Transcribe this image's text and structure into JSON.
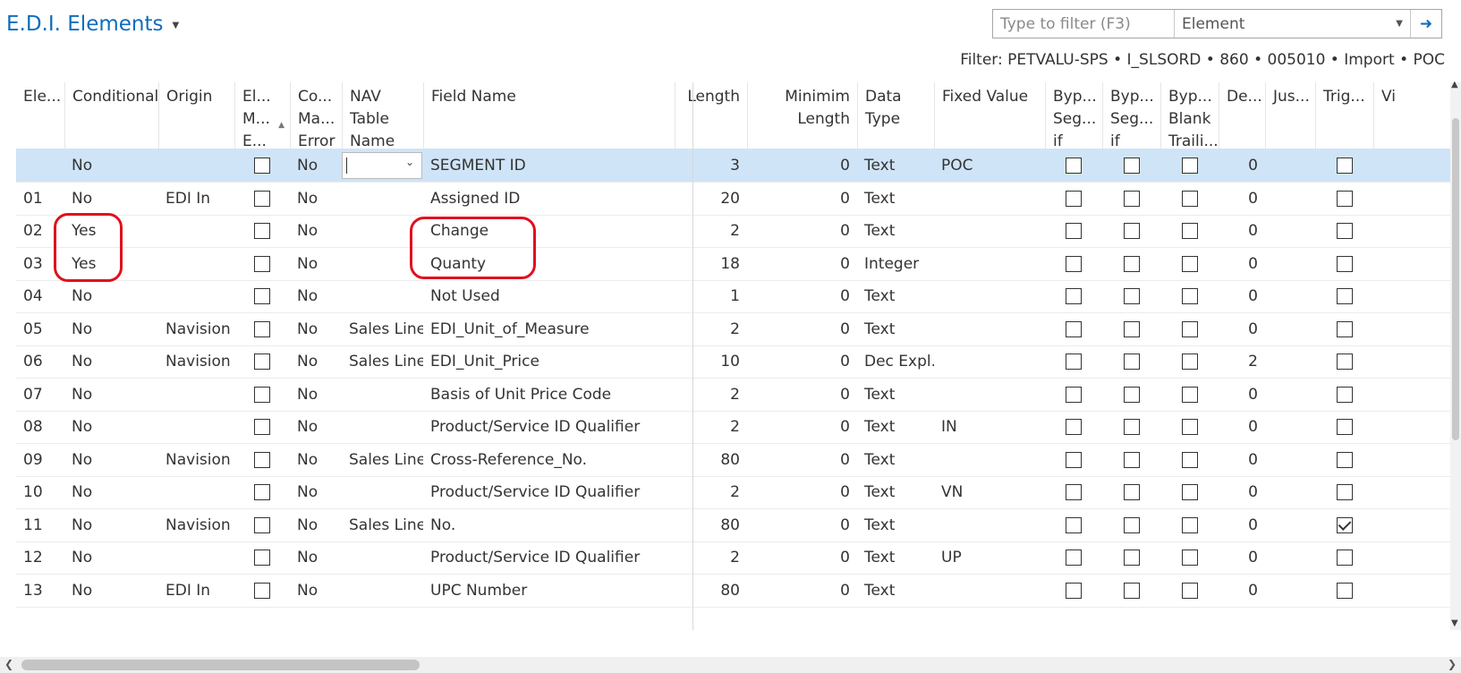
{
  "title": "E.D.I. Elements",
  "filter": {
    "placeholder": "Type to filter (F3)",
    "field": "Element",
    "summary": "Filter: PETVALU-SPS • I_SLSORD • 860 • 005010 • Import • POC"
  },
  "columns": [
    "Ele...",
    "Conditional",
    "Origin",
    "El... M... E...",
    "Co... Ma... Error",
    "NAV Table Name",
    "Field Name",
    "Length",
    "Minimim Length",
    "Data Type",
    "Fixed Value",
    "Byp... Seg... if Bl...",
    "Byp... Seg... if N...",
    "Byp... Blank Traili...",
    "De...",
    "Jus...",
    "Trig...",
    "Vi"
  ],
  "rows": [
    {
      "element": "",
      "conditional": "No",
      "origin": "",
      "error": "No",
      "nav_table": "",
      "field_name": "SEGMENT ID",
      "length": "3",
      "min_length": "0",
      "data_type": "Text",
      "fixed_value": "POC",
      "decimals": "0",
      "trigger": false,
      "selected": true
    },
    {
      "element": "01",
      "conditional": "No",
      "origin": "EDI In",
      "error": "No",
      "nav_table": "",
      "field_name": "Assigned ID",
      "length": "20",
      "min_length": "0",
      "data_type": "Text",
      "fixed_value": "",
      "decimals": "0",
      "trigger": false
    },
    {
      "element": "02",
      "conditional": "Yes",
      "origin": "",
      "error": "No",
      "nav_table": "",
      "field_name": "Change",
      "length": "2",
      "min_length": "0",
      "data_type": "Text",
      "fixed_value": "",
      "decimals": "0",
      "trigger": false
    },
    {
      "element": "03",
      "conditional": "Yes",
      "origin": "",
      "error": "No",
      "nav_table": "",
      "field_name": "Quanty",
      "length": "18",
      "min_length": "0",
      "data_type": "Integer",
      "fixed_value": "",
      "decimals": "0",
      "trigger": false
    },
    {
      "element": "04",
      "conditional": "No",
      "origin": "",
      "error": "No",
      "nav_table": "",
      "field_name": "Not Used",
      "length": "1",
      "min_length": "0",
      "data_type": "Text",
      "fixed_value": "",
      "decimals": "0",
      "trigger": false
    },
    {
      "element": "05",
      "conditional": "No",
      "origin": "Navision",
      "error": "No",
      "nav_table": "Sales Line",
      "field_name": "EDI_Unit_of_Measure",
      "length": "2",
      "min_length": "0",
      "data_type": "Text",
      "fixed_value": "",
      "decimals": "0",
      "trigger": false
    },
    {
      "element": "06",
      "conditional": "No",
      "origin": "Navision",
      "error": "No",
      "nav_table": "Sales Line",
      "field_name": "EDI_Unit_Price",
      "length": "10",
      "min_length": "0",
      "data_type": "Dec Expl...",
      "fixed_value": "",
      "decimals": "2",
      "trigger": false
    },
    {
      "element": "07",
      "conditional": "No",
      "origin": "",
      "error": "No",
      "nav_table": "",
      "field_name": "Basis of Unit Price Code",
      "length": "2",
      "min_length": "0",
      "data_type": "Text",
      "fixed_value": "",
      "decimals": "0",
      "trigger": false
    },
    {
      "element": "08",
      "conditional": "No",
      "origin": "",
      "error": "No",
      "nav_table": "",
      "field_name": "Product/Service ID Qualifier",
      "length": "2",
      "min_length": "0",
      "data_type": "Text",
      "fixed_value": "IN",
      "decimals": "0",
      "trigger": false
    },
    {
      "element": "09",
      "conditional": "No",
      "origin": "Navision",
      "error": "No",
      "nav_table": "Sales Line",
      "field_name": "Cross-Reference_No.",
      "length": "80",
      "min_length": "0",
      "data_type": "Text",
      "fixed_value": "",
      "decimals": "0",
      "trigger": false
    },
    {
      "element": "10",
      "conditional": "No",
      "origin": "",
      "error": "No",
      "nav_table": "",
      "field_name": "Product/Service ID Qualifier",
      "length": "2",
      "min_length": "0",
      "data_type": "Text",
      "fixed_value": "VN",
      "decimals": "0",
      "trigger": false
    },
    {
      "element": "11",
      "conditional": "No",
      "origin": "Navision",
      "error": "No",
      "nav_table": "Sales Line",
      "field_name": "No.",
      "length": "80",
      "min_length": "0",
      "data_type": "Text",
      "fixed_value": "",
      "decimals": "0",
      "trigger": true
    },
    {
      "element": "12",
      "conditional": "No",
      "origin": "",
      "error": "No",
      "nav_table": "",
      "field_name": "Product/Service ID Qualifier",
      "length": "2",
      "min_length": "0",
      "data_type": "Text",
      "fixed_value": "UP",
      "decimals": "0",
      "trigger": false
    },
    {
      "element": "13",
      "conditional": "No",
      "origin": "EDI In",
      "error": "No",
      "nav_table": "",
      "field_name": "UPC Number",
      "length": "80",
      "min_length": "0",
      "data_type": "Text",
      "fixed_value": "",
      "decimals": "0",
      "trigger": false
    }
  ]
}
